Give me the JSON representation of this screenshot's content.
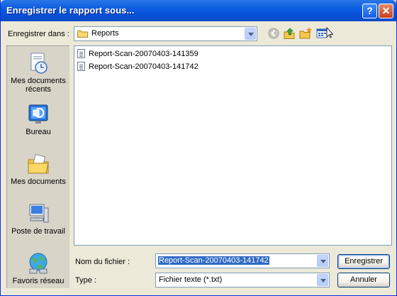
{
  "window": {
    "title": "Enregistrer le rapport sous...",
    "help_label": "?",
    "close_label": "✕"
  },
  "lookin": {
    "label": "Enregistrer dans :",
    "value": "Reports"
  },
  "toolbar": {
    "icons": [
      "back-icon",
      "up-folder-icon",
      "new-folder-icon",
      "view-menu-icon"
    ]
  },
  "places": [
    {
      "label": "Mes documents récents",
      "icon": "recent-documents-icon"
    },
    {
      "label": "Bureau",
      "icon": "desktop-icon"
    },
    {
      "label": "Mes documents",
      "icon": "my-documents-icon"
    },
    {
      "label": "Poste de travail",
      "icon": "my-computer-icon"
    },
    {
      "label": "Favoris réseau",
      "icon": "network-places-icon"
    }
  ],
  "files": [
    {
      "name": "Report-Scan-20070403-141359"
    },
    {
      "name": "Report-Scan-20070403-141742"
    }
  ],
  "filename": {
    "label": "Nom du fichier :",
    "value": "Report-Scan-20070403-141742"
  },
  "filetype": {
    "label": "Type :",
    "value": "Fichier texte (*.txt)"
  },
  "buttons": {
    "save": "Enregistrer",
    "cancel": "Annuler"
  },
  "colors": {
    "titlebar": "#0a5ae0",
    "selection": "#316ac5",
    "dialog_bg": "#ece9d8"
  }
}
